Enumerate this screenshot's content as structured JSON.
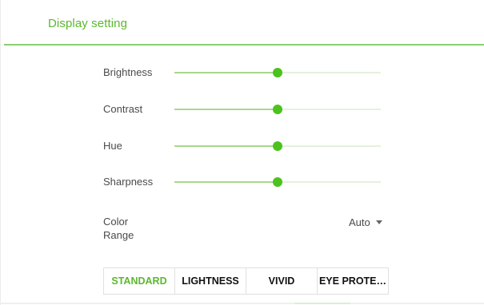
{
  "header": {
    "title": "Display setting"
  },
  "settings": [
    {
      "label": "Brightness",
      "value_fraction": 0.5
    },
    {
      "label": "Contrast",
      "value_fraction": 0.5
    },
    {
      "label": "Hue",
      "value_fraction": 0.5
    },
    {
      "label": "Sharpness",
      "value_fraction": 0.5
    }
  ],
  "color_range": {
    "label": "Color Range",
    "selected": "Auto"
  },
  "modes": [
    {
      "label": "STANDARD",
      "active": true
    },
    {
      "label": "LIGHTNESS",
      "active": false
    },
    {
      "label": "VIVID",
      "active": false
    },
    {
      "label": "EYE PROTE…",
      "active": false
    }
  ],
  "colors": {
    "accent": "#5cb82e",
    "slider_thumb": "#4cc21e",
    "slider_fill": "#a7d98c",
    "slider_track": "#e3f2dc"
  }
}
